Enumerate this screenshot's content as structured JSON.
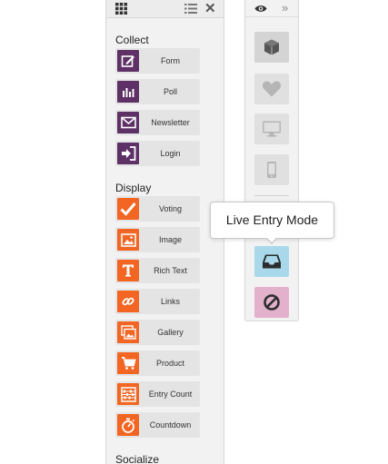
{
  "left_panel": {
    "sections": {
      "collect": {
        "title": "Collect",
        "items": [
          {
            "label": "Form",
            "icon": "edit-icon"
          },
          {
            "label": "Poll",
            "icon": "bar-chart-icon"
          },
          {
            "label": "Newsletter",
            "icon": "envelope-icon"
          },
          {
            "label": "Login",
            "icon": "sign-in-icon"
          }
        ]
      },
      "display": {
        "title": "Display",
        "items": [
          {
            "label": "Voting",
            "icon": "checkmark-icon"
          },
          {
            "label": "Image",
            "icon": "picture-icon"
          },
          {
            "label": "Rich Text",
            "icon": "text-t-icon"
          },
          {
            "label": "Links",
            "icon": "link-icon"
          },
          {
            "label": "Gallery",
            "icon": "gallery-icon"
          },
          {
            "label": "Product",
            "icon": "cart-icon"
          },
          {
            "label": "Entry Count",
            "icon": "abacus-icon"
          },
          {
            "label": "Countdown",
            "icon": "stopwatch-icon"
          }
        ]
      },
      "socialize": {
        "title": "Socialize"
      }
    }
  },
  "toolbar": {
    "buttons": [
      {
        "icon": "cube-icon"
      },
      {
        "icon": "heart-icon"
      },
      {
        "icon": "desktop-icon"
      },
      {
        "icon": "mobile-icon"
      },
      {
        "icon": "inbox-icon",
        "color": "#a9d8ea"
      },
      {
        "icon": "ban-icon",
        "color": "#e4b1cd"
      }
    ]
  },
  "tooltip": {
    "text": "Live Entry Mode"
  },
  "colors": {
    "collect_icon_bg": "#5e3166",
    "display_icon_bg": "#f26522",
    "live_entry_button": "#a9d8ea",
    "disable_button": "#e4b1cd"
  }
}
